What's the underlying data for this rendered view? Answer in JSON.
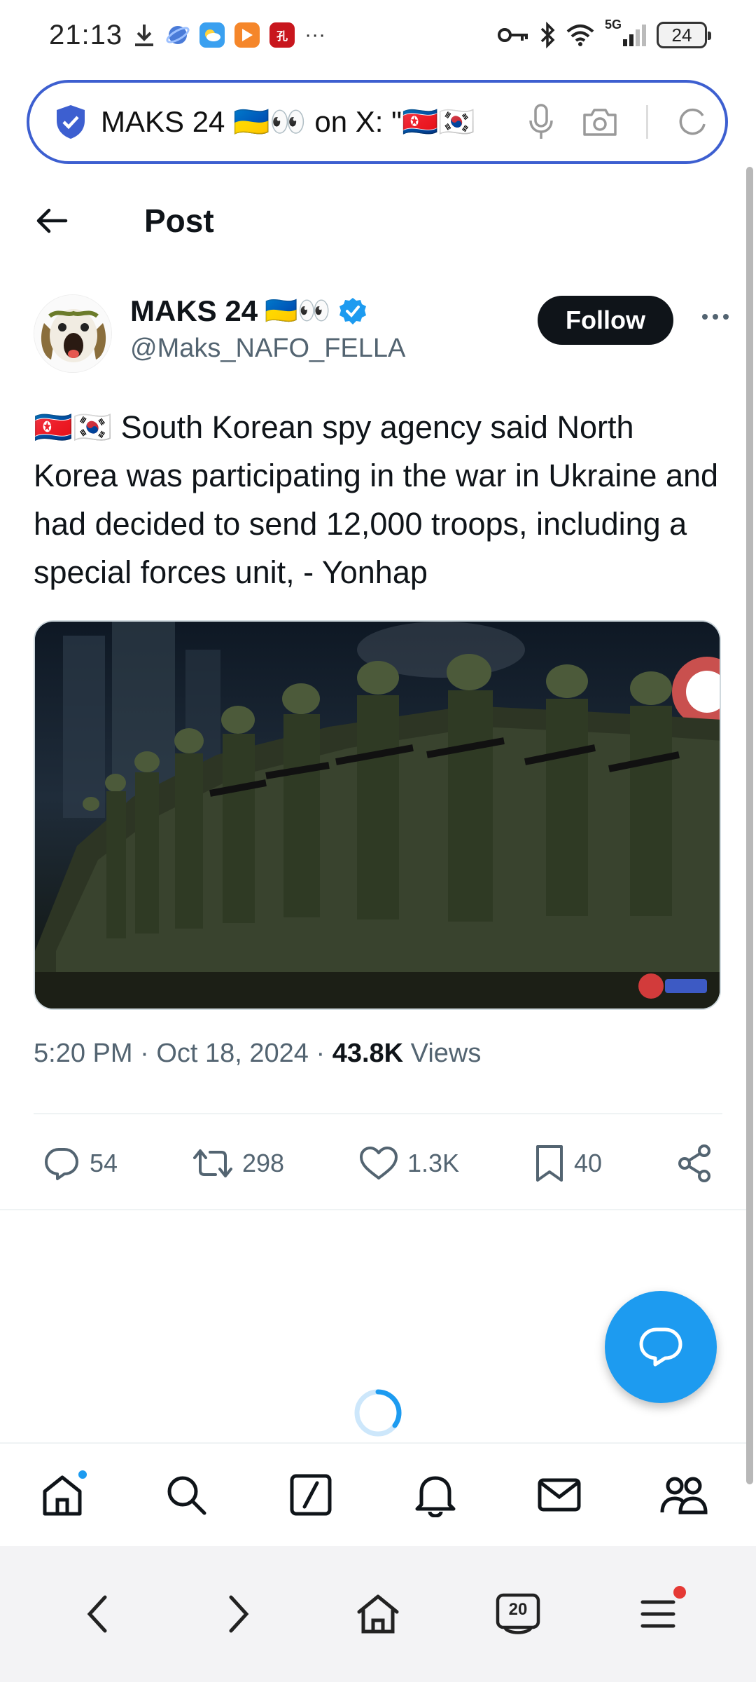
{
  "status_bar": {
    "time": "21:13",
    "overflow": "···",
    "network": "5G",
    "battery": "24"
  },
  "address_bar": {
    "url_text": "MAKS 24 🇺🇦👀 on X: \"🇰🇵🇰🇷"
  },
  "header": {
    "title": "Post"
  },
  "author": {
    "name": "MAKS 24",
    "name_emoji": "🇺🇦👀",
    "handle": "@Maks_NAFO_FELLA",
    "follow_label": "Follow",
    "verified": true
  },
  "tweet": {
    "text": "🇰🇵🇰🇷 South Korean spy agency said North Korea was participating in the war in Ukraine and had decided to send 12,000 troops, including a special forces unit, - Yonhap"
  },
  "meta": {
    "time": "5:20 PM",
    "sep1": "·",
    "date": "Oct 18, 2024",
    "sep2": "·",
    "views_count": "43.8K",
    "views_label": "Views"
  },
  "actions": {
    "replies": "54",
    "reposts": "298",
    "likes": "1.3K",
    "bookmarks": "40"
  },
  "browser_nav": {
    "tabs_count": "20"
  },
  "colors": {
    "accent": "#1d9bf0",
    "text": "#0f1419",
    "muted": "#536471",
    "address_border": "#3d5fd0"
  },
  "icons": {
    "tabbar": [
      "home-icon",
      "search-icon",
      "compose-icon",
      "bell-icon",
      "mail-icon",
      "communities-icon"
    ],
    "browser": [
      "back-icon",
      "forward-icon",
      "home-icon",
      "tabs-icon",
      "menu-icon"
    ]
  }
}
